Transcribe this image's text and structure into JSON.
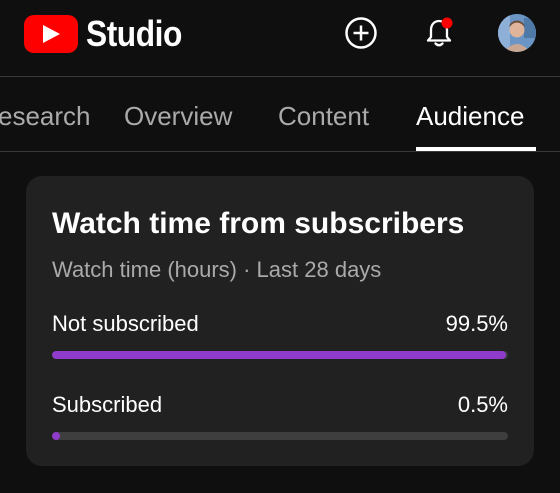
{
  "header": {
    "logo_text": "Studio",
    "icons": [
      "youtube-logo-icon",
      "create-plus-icon",
      "notifications-bell-icon",
      "avatar"
    ],
    "notification_dot_color": "#ff0000",
    "brand_color": "#ff0000"
  },
  "tabs": [
    {
      "label": "esearch",
      "active": false
    },
    {
      "label": "Overview",
      "active": false
    },
    {
      "label": "Content",
      "active": false
    },
    {
      "label": "Audience",
      "active": true
    }
  ],
  "card": {
    "title": "Watch time from subscribers",
    "subtitle": "Watch time (hours) · Last 28 days",
    "bar_color": "#8f3ccc",
    "rows": [
      {
        "label": "Not subscribed",
        "value": "99.5%",
        "fraction": 0.995
      },
      {
        "label": "Subscribed",
        "value": "0.5%",
        "fraction": 0.005
      }
    ]
  }
}
